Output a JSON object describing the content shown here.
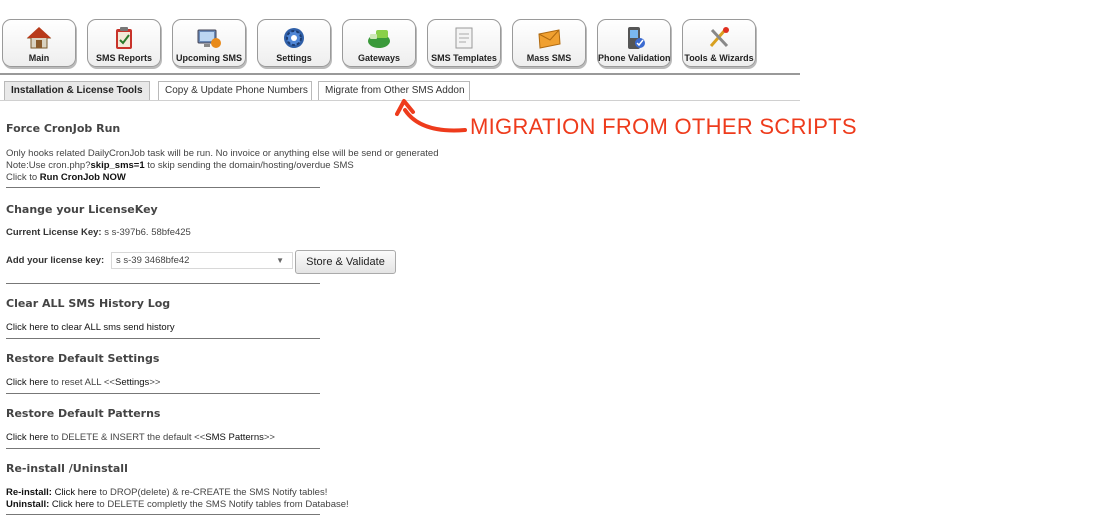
{
  "toolbar": {
    "buttons": [
      {
        "label": "Main",
        "icon": "house-icon"
      },
      {
        "label": "SMS Reports",
        "icon": "clipboard-check-icon"
      },
      {
        "label": "Upcoming SMS",
        "icon": "monitor-mail-icon"
      },
      {
        "label": "Settings",
        "icon": "gear-icon"
      },
      {
        "label": "Gateways",
        "icon": "gateway-icon"
      },
      {
        "label": "SMS Templates",
        "icon": "template-icon"
      },
      {
        "label": "Mass SMS",
        "icon": "envelope-icon"
      },
      {
        "label": "Phone Validation",
        "icon": "phone-check-icon"
      },
      {
        "label": "Tools & Wizards",
        "icon": "tools-icon"
      }
    ]
  },
  "tabs": [
    {
      "label": "Installation & License Tools",
      "active": true
    },
    {
      "label": "Copy & Update Phone Numbers",
      "active": false
    },
    {
      "label": "Migrate from Other SMS Addon",
      "active": false
    }
  ],
  "annotation": {
    "text": "MIGRATION FROM OTHER SCRIPTS",
    "color": "#ee3b1c"
  },
  "cron": {
    "title": "Force CronJob Run",
    "line1": "Only hooks related DailyCronJob task will be run. No invoice or anything else will be send or generated",
    "line2_prefix": "Note:Use cron.php?",
    "line2_bold": "skip_sms=1",
    "line2_suffix": " to skip sending the domain/hosting/overdue SMS",
    "line3_prefix": "Click to ",
    "line3_link": "Run CronJob NOW"
  },
  "license": {
    "title": "Change your LicenseKey",
    "current_label": "Current License Key:",
    "current_value": "s  s-397b6.       58bfe425",
    "add_label": "Add your license key:",
    "input_value": "s  s-39    3468bfe42",
    "button": "Store & Validate"
  },
  "history": {
    "title": "Clear ALL SMS History Log",
    "link": "Click here to clear ALL sms send history"
  },
  "settings": {
    "title": "Restore Default Settings",
    "link": "Click here",
    "suffix_a": " to reset ALL <<",
    "bold": "Settings",
    "suffix_b": ">>"
  },
  "patterns": {
    "title": "Restore Default Patterns",
    "link": "Click here",
    "suffix_a": " to DELETE & INSERT the default <<",
    "bold": "SMS Patterns",
    "suffix_b": ">>"
  },
  "reinstall": {
    "title": "Re-install /Uninstall",
    "l1_label": "Re-install:",
    "l1_link": " Click here",
    "l1_suffix": " to DROP(delete) & re-CREATE the SMS Notify tables!",
    "l2_label": "Uninstall:",
    "l2_link": " Click here",
    "l2_suffix": " to DELETE completly the SMS Notify tables from Database!"
  }
}
